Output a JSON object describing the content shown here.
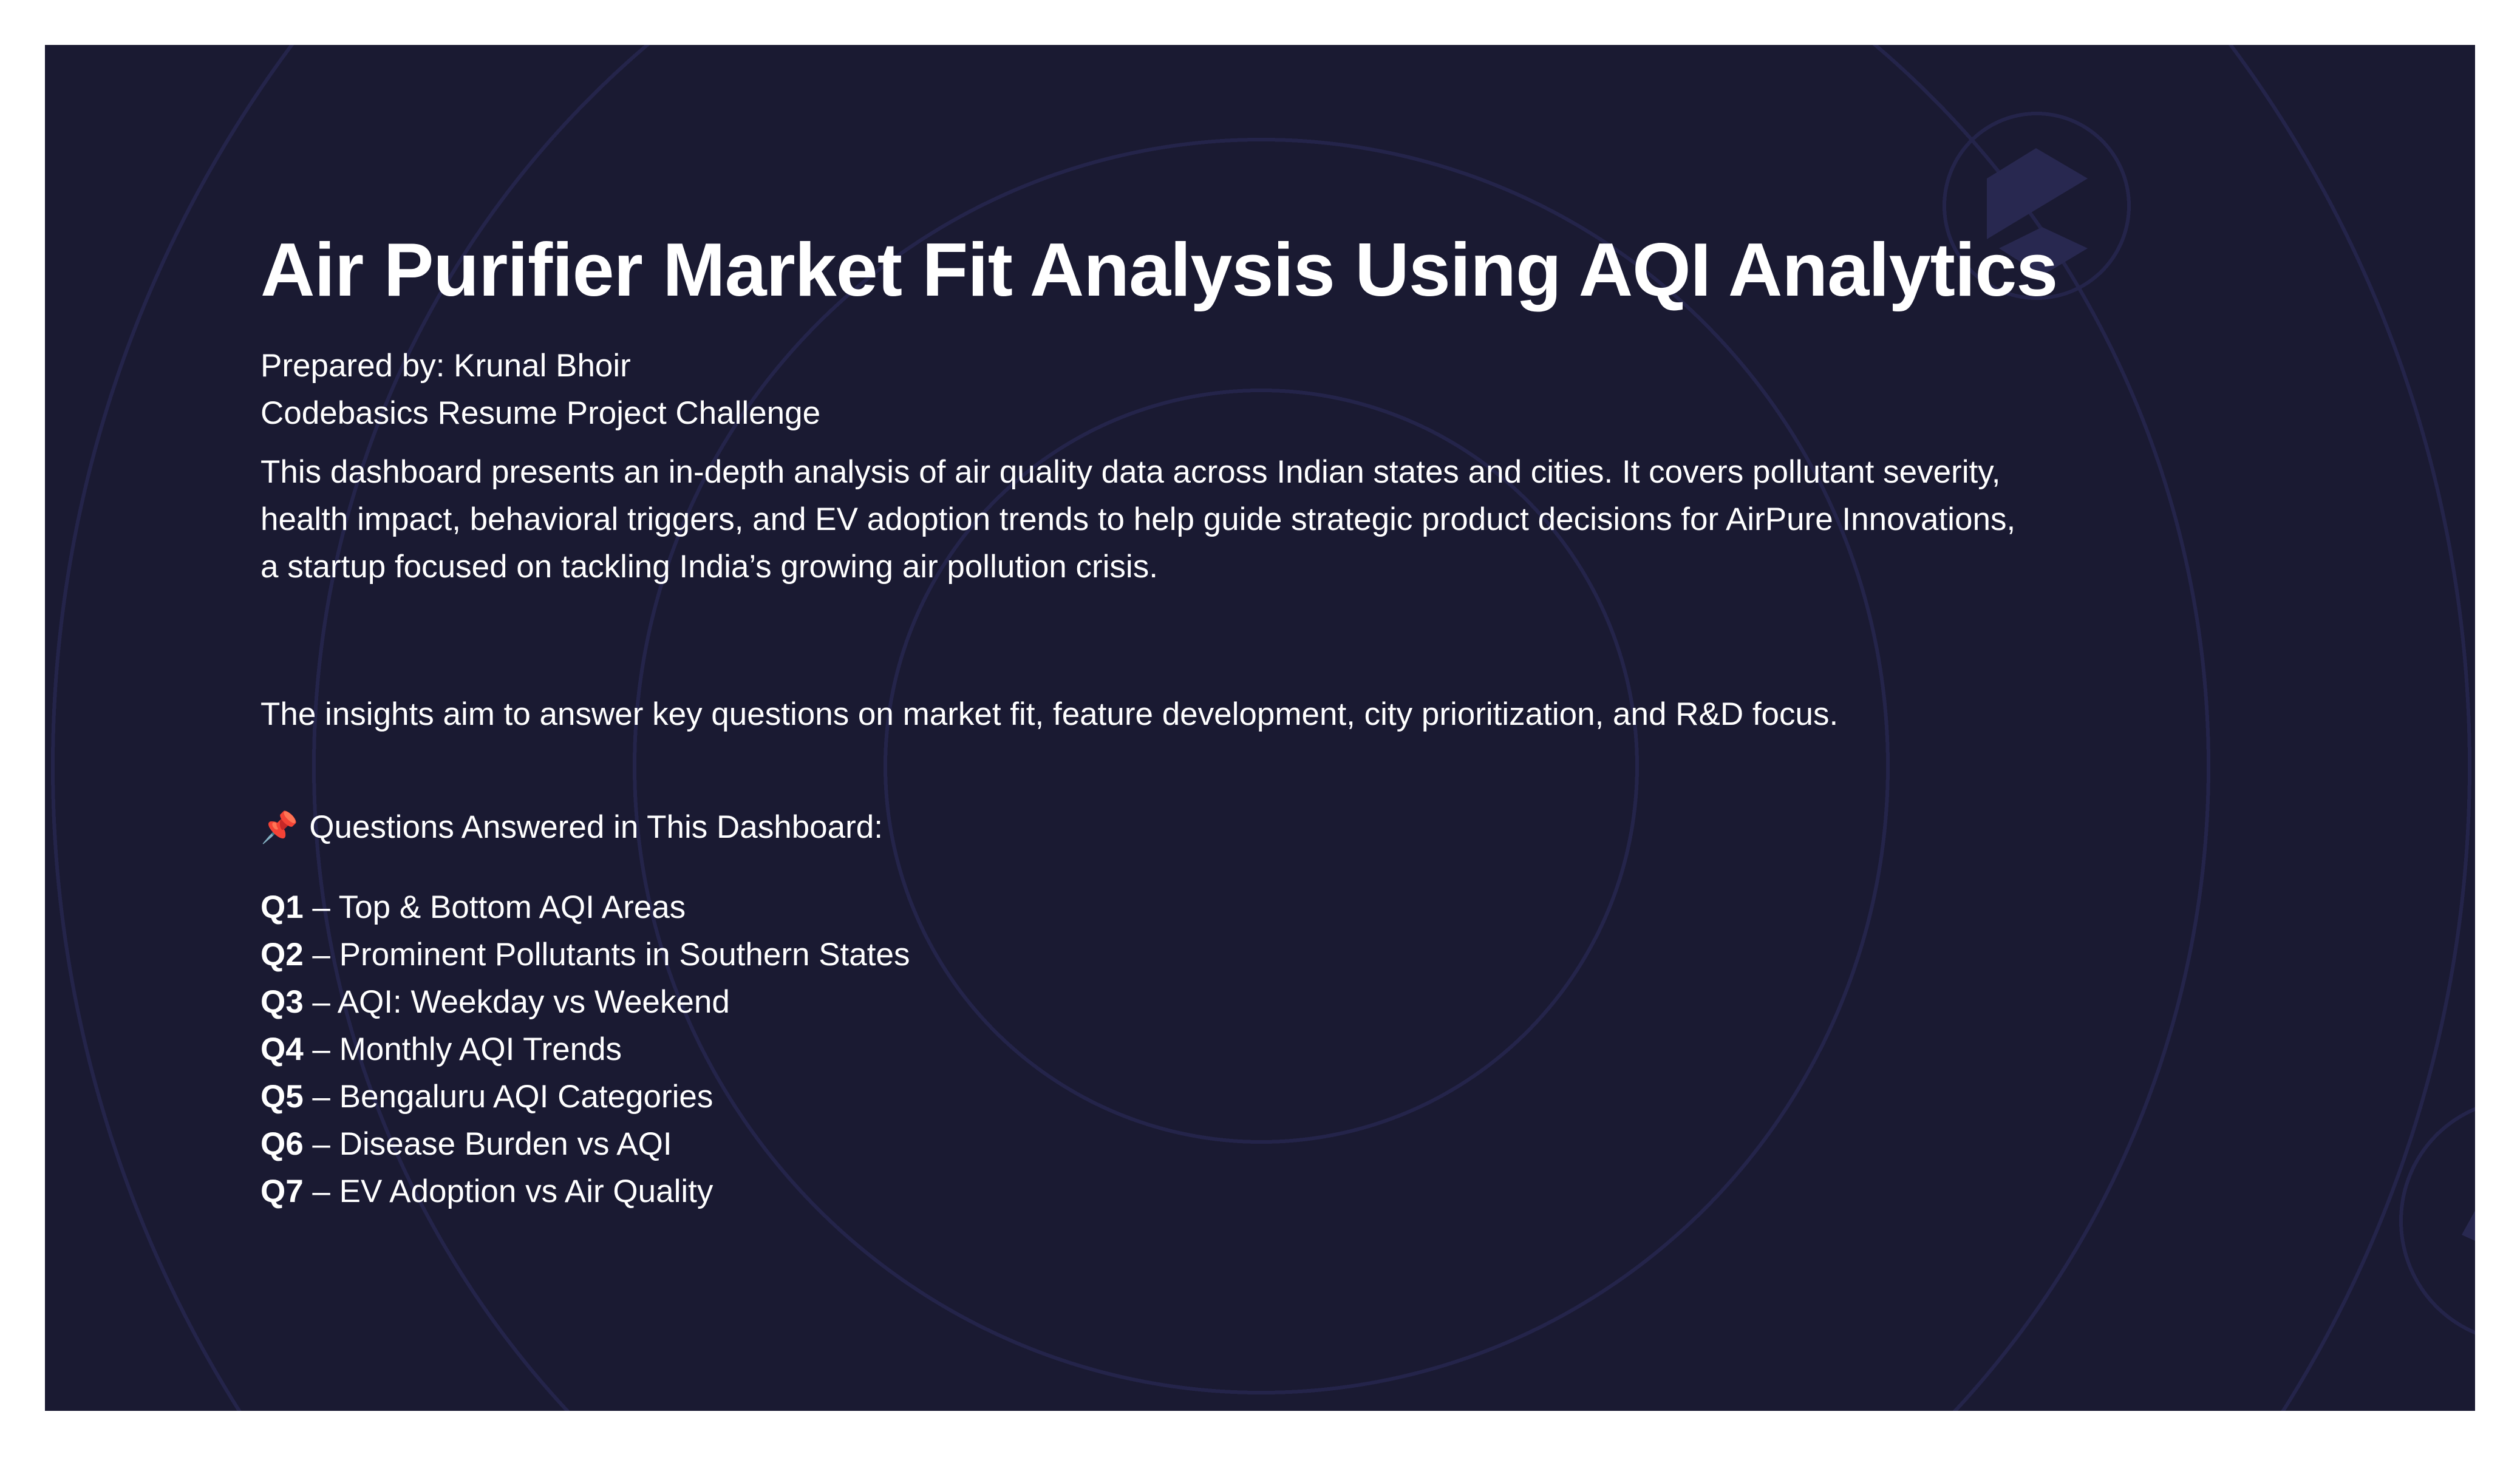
{
  "title": "Air Purifier Market Fit Analysis Using AQI Analytics",
  "prepared_by": "Prepared by: Krunal Bhoir",
  "challenge": "Codebasics Resume Project Challenge",
  "description_lines": [
    "This dashboard presents an in-depth analysis of air quality data across Indian states and cities. It covers pollutant severity,",
    "health impact, behavioral triggers, and EV adoption trends to help guide strategic product decisions for AirPure Innovations,",
    "a startup focused on tackling India’s growing air pollution crisis."
  ],
  "insights": "The insights aim to answer key questions on market fit, feature development, city prioritization, and R&D focus.",
  "questions_heading": "Questions Answered in This Dashboard:",
  "questions_icon": "pushpin-icon",
  "questions": [
    {
      "id": "Q1",
      "text": " – Top & Bottom AQI Areas"
    },
    {
      "id": "Q2",
      "text": " – Prominent Pollutants in Southern States"
    },
    {
      "id": "Q3",
      "text": " – AQI: Weekday vs Weekend"
    },
    {
      "id": "Q4",
      "text": " – Monthly AQI Trends"
    },
    {
      "id": "Q5",
      "text": " – Bengaluru AQI Categories"
    },
    {
      "id": "Q6",
      "text": " – Disease Burden vs AQI"
    },
    {
      "id": "Q7",
      "text": " – EV Adoption vs Air Quality"
    }
  ],
  "colors": {
    "background": "#1a1a32",
    "ring": "#25254a",
    "logo": "#282850",
    "text": "#ffffff",
    "pin": "#e8365a"
  }
}
